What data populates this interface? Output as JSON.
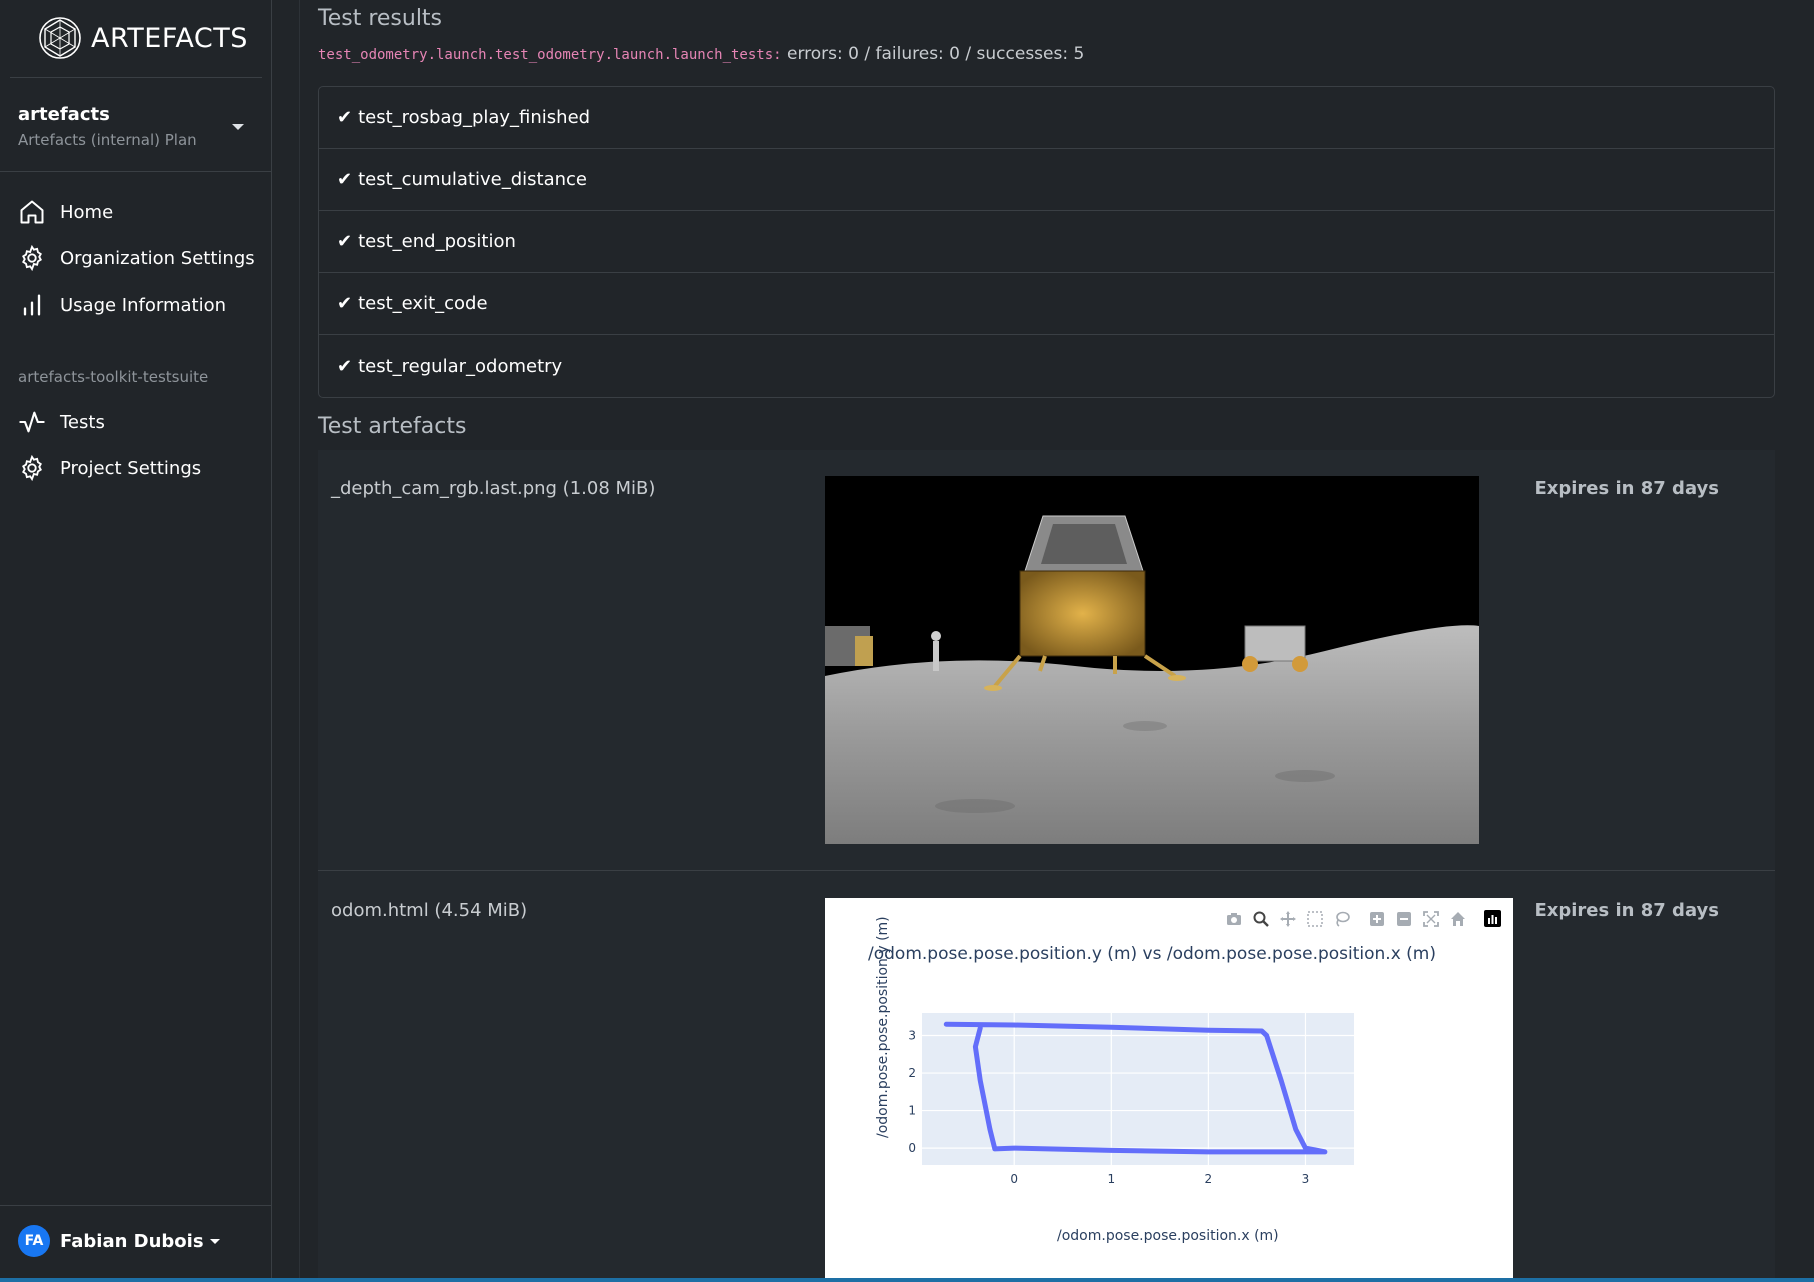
{
  "brand": {
    "name": "ARTEFACTS"
  },
  "org": {
    "name": "artefacts",
    "plan": "Artefacts (internal) Plan"
  },
  "nav": [
    {
      "label": "Home",
      "icon": "home-icon"
    },
    {
      "label": "Organization Settings",
      "icon": "gear-icon"
    },
    {
      "label": "Usage Information",
      "icon": "bar-chart-icon"
    }
  ],
  "project": {
    "name": "artefacts-toolkit-testsuite",
    "nav": [
      {
        "label": "Tests",
        "icon": "activity-icon"
      },
      {
        "label": "Project Settings",
        "icon": "gear-icon"
      }
    ]
  },
  "user": {
    "initials": "FA",
    "name": "Fabian Dubois"
  },
  "results": {
    "title": "Test results",
    "suite": "test_odometry.launch.test_odometry.launch.launch_tests:",
    "summary": " errors: 0 / failures: 0 / successes: 5",
    "tests": [
      "test_rosbag_play_finished",
      "test_cumulative_distance",
      "test_end_position",
      "test_exit_code",
      "test_regular_odometry"
    ],
    "check_glyph": "✔"
  },
  "artefacts": {
    "title": "Test artefacts",
    "items": [
      {
        "name": "_depth_cam_rgb.last.png (1.08 MiB)",
        "expires": "Expires in 87 days"
      },
      {
        "name": "odom.html (4.54 MiB)",
        "expires": "Expires in 87 days"
      }
    ]
  },
  "chart_data": {
    "type": "line",
    "title": "/odom.pose.pose.position.y (m) vs /odom.pose.pose.position.x (m)",
    "xlabel": "/odom.pose.pose.position.x (m)",
    "ylabel": "/odom.pose.pose.position.y (m)",
    "xlim": [
      -0.95,
      3.5
    ],
    "ylim": [
      -0.45,
      3.6
    ],
    "xticks": [
      "0",
      "1",
      "2",
      "3"
    ],
    "yticks": [
      "0",
      "1",
      "2",
      "3"
    ],
    "series": [
      {
        "color": "#636efa",
        "x": [
          -0.7,
          0.0,
          1.0,
          2.0,
          2.55,
          2.6,
          2.75,
          2.9,
          3.0,
          3.2,
          2.0,
          1.0,
          0.0,
          -0.2,
          -0.25,
          -0.35,
          -0.4,
          -0.35
        ],
        "y": [
          3.3,
          3.28,
          3.22,
          3.14,
          3.12,
          3.0,
          1.8,
          0.5,
          0.0,
          -0.1,
          -0.1,
          -0.06,
          0.0,
          -0.02,
          0.5,
          1.8,
          2.7,
          3.2
        ]
      }
    ],
    "grid": true,
    "background": "#e5ecf6"
  },
  "colors": {
    "accent": "#1877f2",
    "code": "#e685b5",
    "trace": "#636efa"
  }
}
